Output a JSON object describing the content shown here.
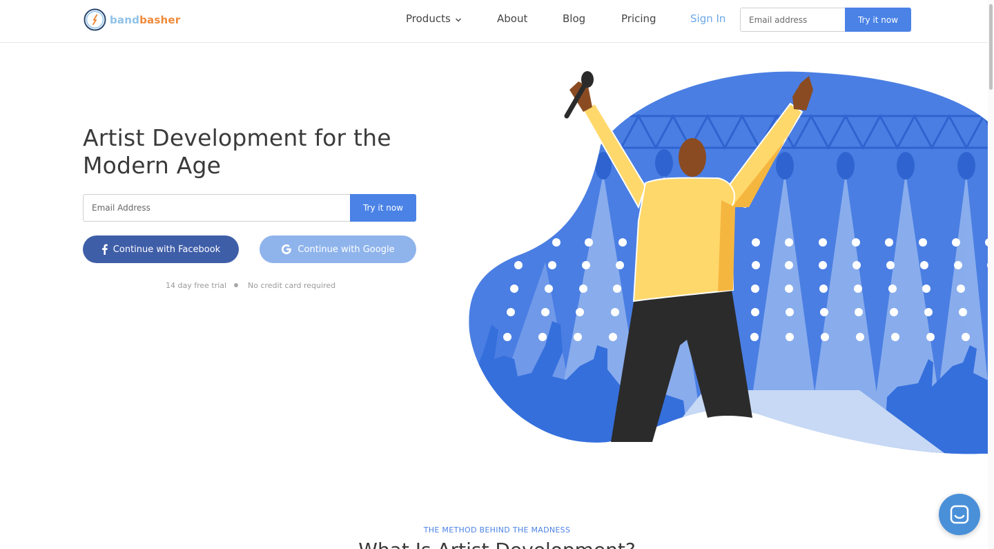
{
  "header": {
    "logo": {
      "band": "band",
      "basher": "basher"
    },
    "nav": {
      "products": "Products",
      "about": "About",
      "blog": "Blog",
      "pricing": "Pricing",
      "sign_in": "Sign In"
    },
    "email_placeholder": "Email address",
    "try_label": "Try it now"
  },
  "hero": {
    "title": "Artist Development for the Modern Age",
    "email_placeholder": "Email Address",
    "try_label": "Try it now",
    "facebook_label": "Continue with Facebook",
    "google_label": "Continue with Google",
    "notes": [
      "14 day free trial",
      "No credit card required"
    ]
  },
  "section": {
    "eyebrow": "THE METHOD BEHIND THE MADNESS",
    "title": "What Is Artist Development?"
  },
  "icons": {
    "logo": "compass-logo-icon",
    "products_chevron": "chevron-down-icon",
    "facebook": "facebook-icon",
    "google": "google-icon",
    "chat": "chat-icon"
  },
  "colors": {
    "primary": "#4a82e6",
    "facebook": "#3f5ea8",
    "google": "#8fb4ec",
    "link": "#6aa6e6",
    "logo_band": "#8fc2e8",
    "logo_basher": "#f08a3a",
    "illustration_blue": "#4a82e6",
    "shirt_yellow": "#ffd86b"
  }
}
